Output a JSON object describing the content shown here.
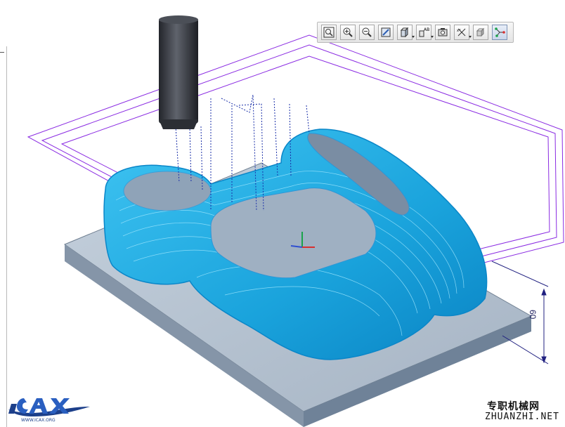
{
  "toolbar": {
    "buttons": [
      {
        "icon": "zoom-fit-icon",
        "label": "Refit"
      },
      {
        "icon": "zoom-in-icon",
        "label": "Zoom In"
      },
      {
        "icon": "zoom-out-icon",
        "label": "Zoom Out"
      },
      {
        "icon": "repaint-icon",
        "label": "Repaint"
      },
      {
        "icon": "display-style-icon",
        "label": "Display Style"
      },
      {
        "icon": "saved-views-icon",
        "label": "Saved Views"
      },
      {
        "icon": "view-manager-icon",
        "label": "View Manager"
      },
      {
        "icon": "datum-display-icon",
        "label": "Datum Display"
      },
      {
        "icon": "spin-center-icon",
        "label": "Spin Center"
      },
      {
        "icon": "tool-path-icon",
        "label": "Tool Path",
        "active": true
      }
    ]
  },
  "dimension": {
    "value": "60"
  },
  "watermark": {
    "logo_text": "ICAX",
    "logo_url": "WWW.ICAX.ORG",
    "brand_cn": "专职机械网",
    "brand_url": "ZHUANZHI.NET"
  },
  "colors": {
    "background": "#ffffff",
    "stock_top": "#b7c4d2",
    "stock_side": "#7b8fa6",
    "toolpath": "#00a8e8",
    "boundary": "#8a2be2",
    "tool": "#3a3d44",
    "dimension": "#202080"
  }
}
